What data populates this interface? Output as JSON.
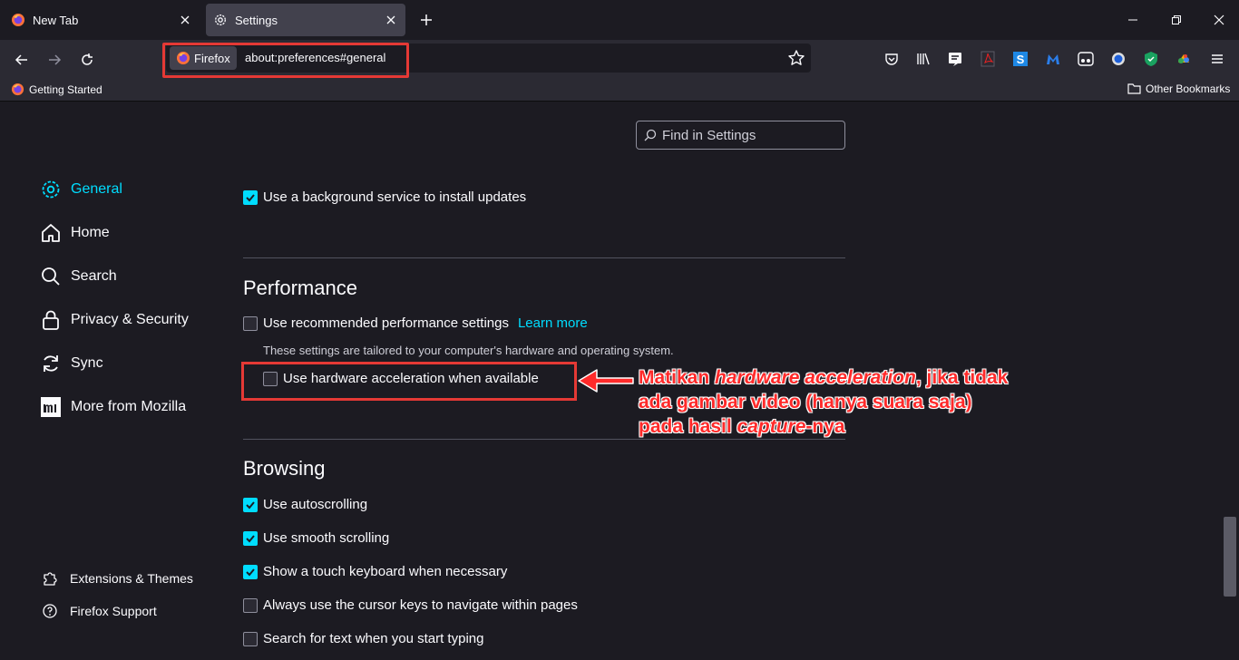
{
  "tabs": [
    {
      "label": "New Tab",
      "icon": "firefox-icon"
    },
    {
      "label": "Settings",
      "icon": "gear-icon"
    }
  ],
  "urlbar": {
    "identity_label": "Firefox",
    "url": "about:preferences#general"
  },
  "bookmarks": {
    "getting_started": "Getting Started",
    "other": "Other Bookmarks"
  },
  "search": {
    "placeholder": "Find in Settings"
  },
  "sidebar": {
    "items": [
      {
        "label": "General",
        "icon": "gear-icon",
        "selected": true
      },
      {
        "label": "Home",
        "icon": "home-icon"
      },
      {
        "label": "Search",
        "icon": "search-icon"
      },
      {
        "label": "Privacy & Security",
        "icon": "lock-icon"
      },
      {
        "label": "Sync",
        "icon": "sync-icon"
      },
      {
        "label": "More from Mozilla",
        "icon": "mozilla-icon"
      }
    ],
    "footer": [
      {
        "label": "Extensions & Themes",
        "icon": "puzzle-icon"
      },
      {
        "label": "Firefox Support",
        "icon": "help-icon"
      }
    ]
  },
  "updates": {
    "background_service": {
      "label": "Use a background service to install updates",
      "checked": true
    }
  },
  "performance": {
    "heading": "Performance",
    "recommended": {
      "label": "Use recommended performance settings",
      "checked": false
    },
    "learn_more": "Learn more",
    "hint": "These settings are tailored to your computer's hardware and operating system.",
    "hardware_accel": {
      "label": "Use hardware acceleration when available",
      "checked": false
    }
  },
  "browsing": {
    "heading": "Browsing",
    "options": [
      {
        "label": "Use autoscrolling",
        "checked": true
      },
      {
        "label": "Use smooth scrolling",
        "checked": true
      },
      {
        "label": "Show a touch keyboard when necessary",
        "checked": true
      },
      {
        "label": "Always use the cursor keys to navigate within pages",
        "checked": false
      },
      {
        "label": "Search for text when you start typing",
        "checked": false
      }
    ]
  },
  "annotation": {
    "line1_a": "Matikan ",
    "line1_b": "hardware acceleration",
    "line1_c": ", jika tidak",
    "line2": "ada gambar video (hanya suara saja)",
    "line3_a": "pada hasil ",
    "line3_b": "capture",
    "line3_c": "-nya"
  },
  "colors": {
    "accent": "#00ddff",
    "annotation": "#ff2a2a",
    "highlight_box": "#e53935"
  }
}
